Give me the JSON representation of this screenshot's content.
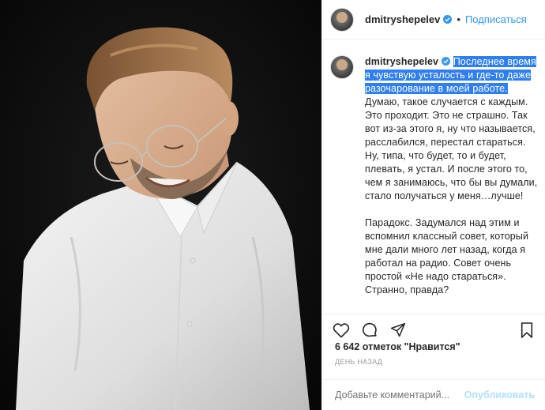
{
  "post": {
    "username": "dmitryshepelev",
    "follow_label": "Подписаться",
    "separator": "•",
    "caption": {
      "highlighted": "Последнее время я чувствую усталость и где-то даже разочарование в моей работе.",
      "text1": " Думаю, такое случается с каждым. Это проходит. Это не страшно. Так вот из-за этого я, ну что называется, расслабился, перестал стараться. Ну, типа, что будет, то и будет, плевать, я устал. И после этого то, чем я занимаюсь, что бы вы думали, стало получаться у меня…лучше!",
      "text2": "Парадокс. Задумался над этим и вспомнил классный совет, который мне дали много лет назад, когда я работал на радио. Совет очень простой «Не надо стараться». Странно, правда?"
    },
    "likes_text": "6 642 отметок \"Нравится\"",
    "time_text": "ДЕНЬ НАЗАД",
    "comment_placeholder": "Добавьте комментарий...",
    "publish_label": "Опубликовать"
  },
  "colors": {
    "accent": "#3897f0",
    "highlight": "#2f7ff0",
    "publish_disabled": "#b2dffc",
    "photo_bg": "#0c0c0c"
  },
  "icons": [
    "verified-badge-icon",
    "heart-icon",
    "comment-icon",
    "share-icon",
    "bookmark-icon"
  ]
}
